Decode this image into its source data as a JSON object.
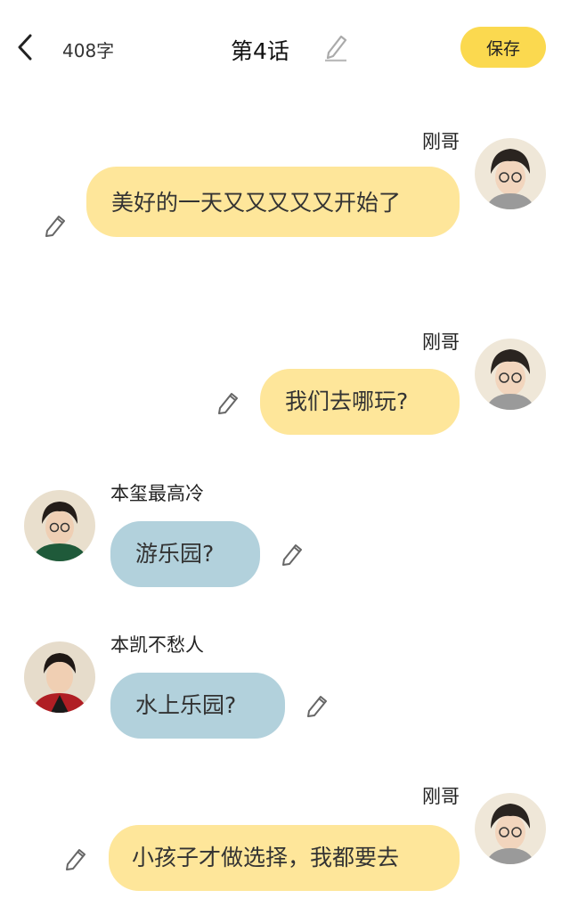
{
  "header": {
    "back_icon": "chevron-left-icon",
    "word_count": "408字",
    "title": "第4话",
    "edit_icon": "pencil-icon",
    "save_label": "保存",
    "accent_color": "#fbd94f"
  },
  "colors": {
    "right_bubble": "#fee69a",
    "left_bubble": "#b2d1dc"
  },
  "messages": [
    {
      "sender": "刚哥",
      "side": "right",
      "text": "美好的一天又又又又又开始了"
    },
    {
      "sender": "刚哥",
      "side": "right",
      "text": "我们去哪玩?"
    },
    {
      "sender": "本玺最高冷",
      "side": "left",
      "text": "游乐园?"
    },
    {
      "sender": "本凯不愁人",
      "side": "left",
      "text": "水上乐园?"
    },
    {
      "sender": "刚哥",
      "side": "right",
      "text": "小孩子才做选择，我都要去"
    }
  ]
}
